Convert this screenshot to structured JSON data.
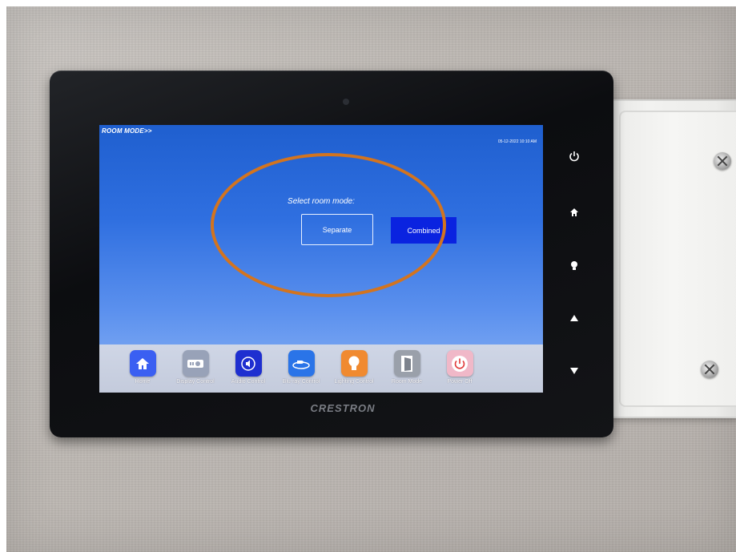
{
  "screen": {
    "mode_link": "ROOM MODE>>",
    "datetime": "05-12-2022 10:10 AM",
    "prompt": "Select room mode:",
    "separate_label": "Separate",
    "combined_label": "Combined"
  },
  "dock": {
    "items": [
      {
        "label": "Home",
        "icon": "home-icon",
        "tile_color": "#3a5ff2"
      },
      {
        "label": "Display Control",
        "icon": "projector-icon",
        "tile_color": "#98a2b8"
      },
      {
        "label": "Audio Control",
        "icon": "speaker-icon",
        "tile_color": "#1e2fd0"
      },
      {
        "label": "Blu-ray Control",
        "icon": "bluray-disc-icon",
        "tile_color": "#2a74e8"
      },
      {
        "label": "Lighting Control",
        "icon": "lightbulb-icon",
        "tile_color": "#f08a30"
      },
      {
        "label": "Room Mode",
        "icon": "door-icon",
        "tile_color": "#9aa0aa"
      },
      {
        "label": "Power Off",
        "icon": "power-icon",
        "tile_color": "#f0b8c8"
      }
    ]
  },
  "side_buttons": [
    "power-icon",
    "home-icon",
    "lightbulb-icon",
    "arrow-up-icon",
    "arrow-down-icon"
  ],
  "device": {
    "brand": "CRESTRON"
  },
  "colors": {
    "screen_blue": "#2f6fe0",
    "combined_button": "#0a23e0",
    "annotation_ring": "#d3741f"
  }
}
